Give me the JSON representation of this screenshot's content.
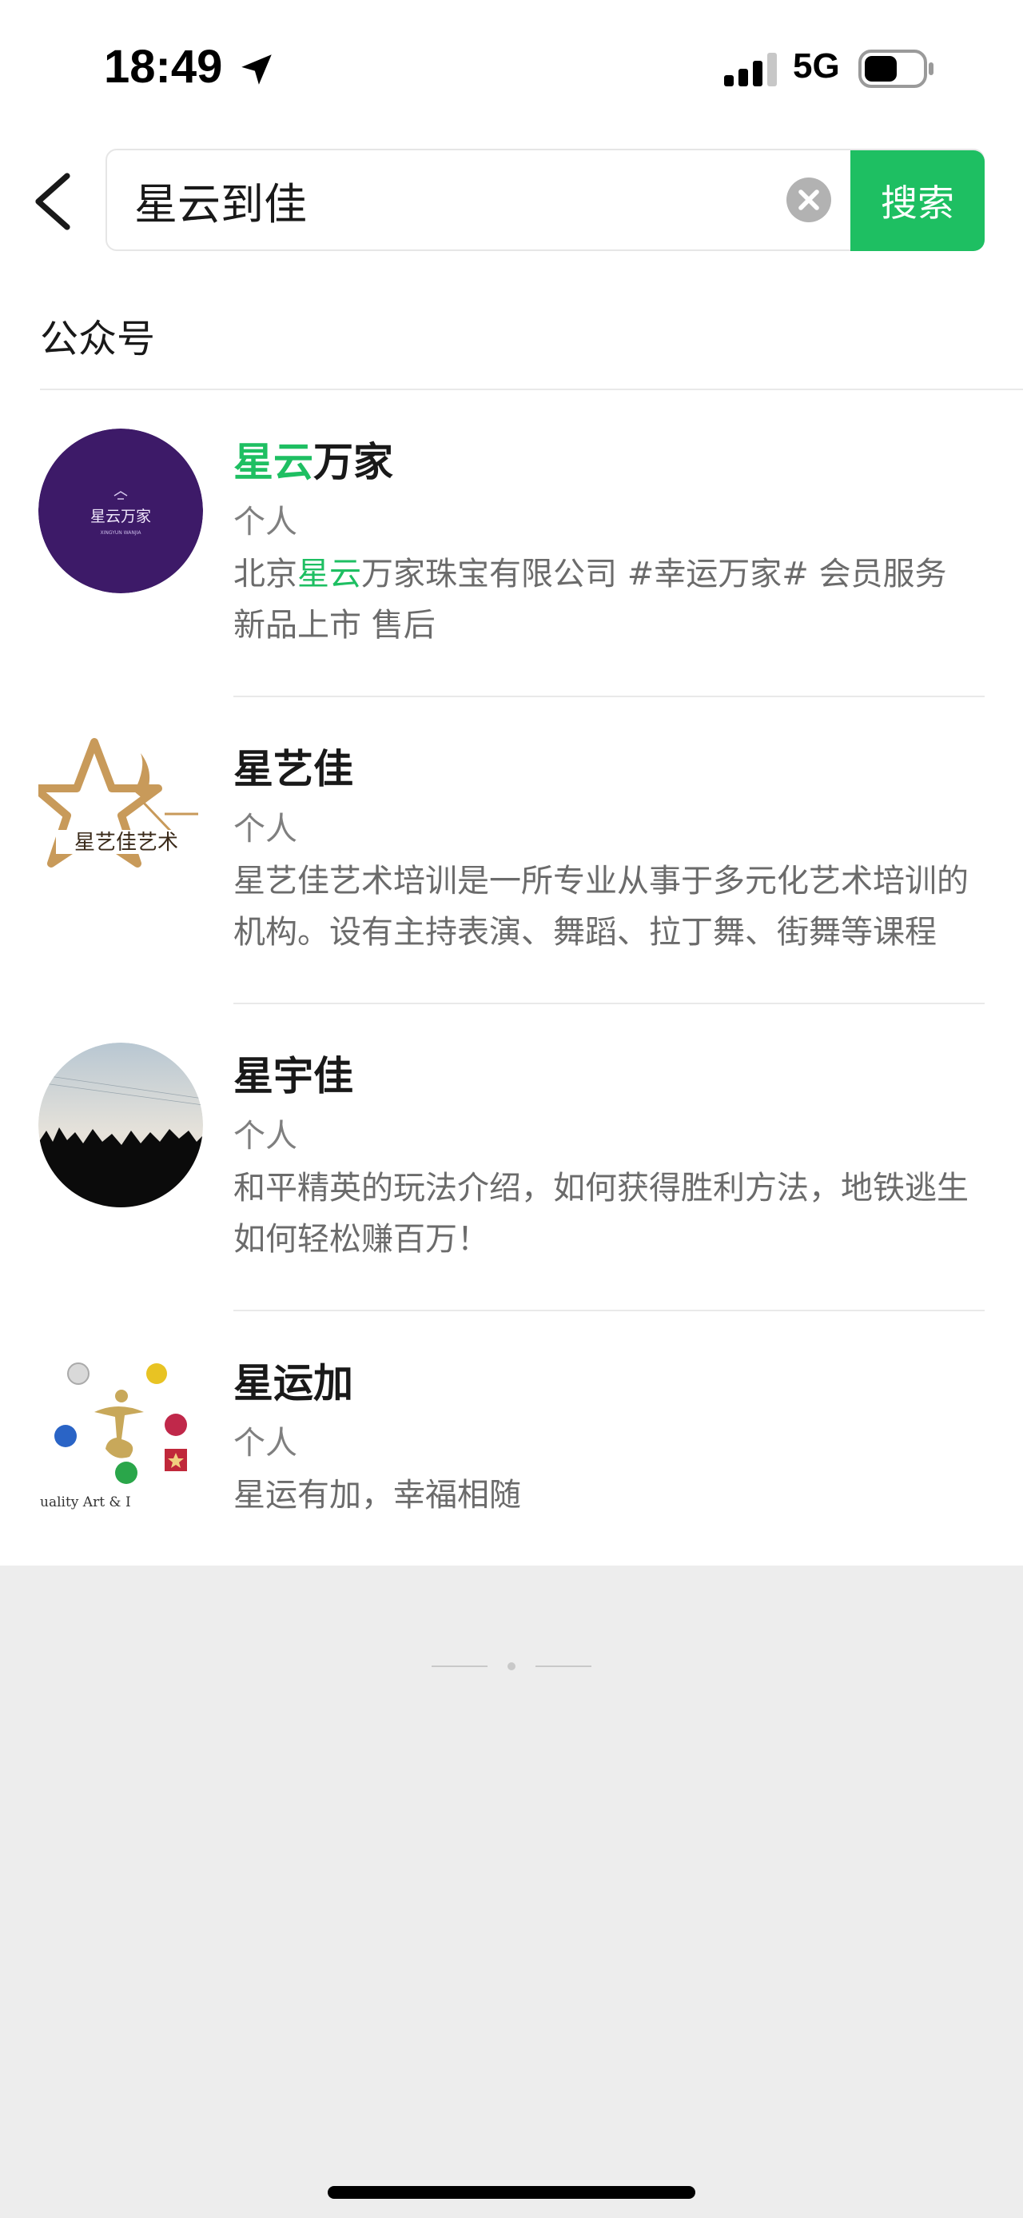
{
  "status_bar": {
    "time": "18:49",
    "network": "5G",
    "location_icon": "location-arrow-icon",
    "signal_icon": "cellular-signal-icon",
    "battery_icon": "battery-icon"
  },
  "search": {
    "query": "星云到佳",
    "button_label": "搜索",
    "back_icon": "chevron-left-icon",
    "clear_icon": "clear-circle-icon"
  },
  "section": {
    "title": "公众号"
  },
  "results": [
    {
      "title_highlight": "星云",
      "title_rest": "万家",
      "type": "个人",
      "desc_pre": "北京",
      "desc_highlight": "星云",
      "desc_post": "万家珠宝有限公司 #幸运万家# 会员服务 新品上市 售后",
      "avatar_text": "星云万家",
      "avatar_subtext": "XINGYUN WANJIA"
    },
    {
      "title": "星艺佳",
      "type": "个人",
      "desc": "星艺佳艺术培训是一所专业从事于多元化艺术培训的机构。设有主持表演、舞蹈、拉丁舞、街舞等课程",
      "avatar_text": "星艺佳艺术"
    },
    {
      "title": "星宇佳",
      "type": "个人",
      "desc": "和平精英的玩法介绍，如何获得胜利方法，地铁逃生如何轻松赚百万！"
    },
    {
      "title": "星运加",
      "type": "个人",
      "desc": "星运有加，幸福相随",
      "avatar_text": "uality Art & I"
    }
  ],
  "colors": {
    "accent": "#1ebf62",
    "background": "#ededed",
    "text_primary": "#191919",
    "text_secondary": "#7f7f7f"
  }
}
